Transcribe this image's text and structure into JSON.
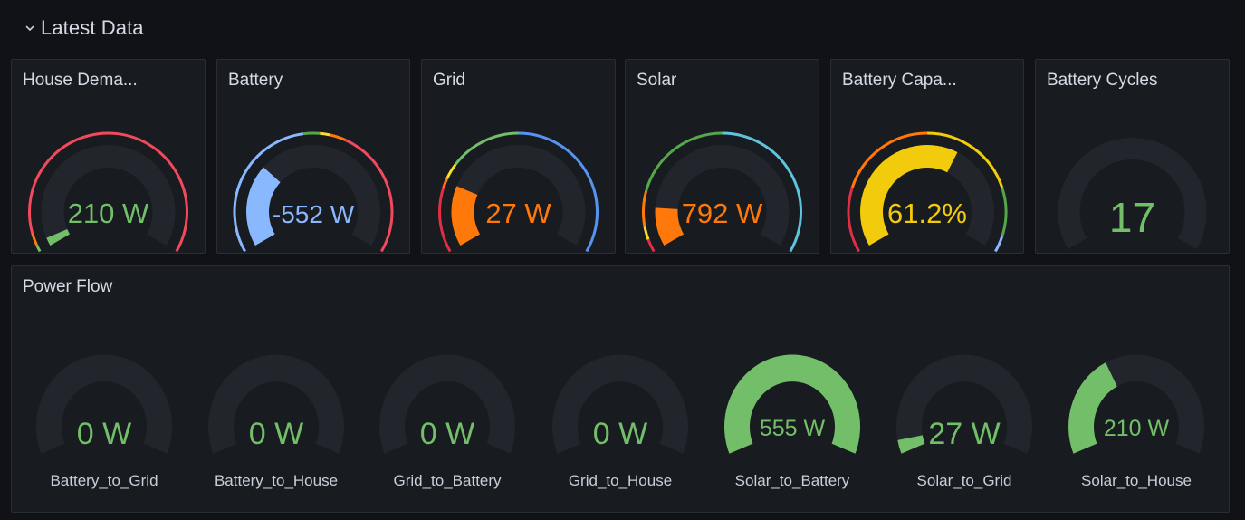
{
  "row": {
    "title": "Latest Data",
    "collapse_icon": "chevron-down-icon"
  },
  "colors": {
    "green": "#73bf69",
    "dark_green": "#56a64b",
    "red": "#f2495c",
    "dark_red": "#e02f44",
    "orange": "#ff780a",
    "yellow": "#f2cc0c",
    "light_yellow": "#fade2a",
    "blue": "#8ab8ff",
    "mid_blue": "#5794f2",
    "cyan": "#5ec4dc",
    "track": "#22252b",
    "panel_bg": "#181b1f",
    "page_bg": "#111217"
  },
  "stat_panels": [
    {
      "id": "house-demand",
      "title": "House Dema...",
      "value_text": "210 W",
      "value_color": "#73bf69",
      "fill_fraction": 0.03,
      "fill_color": "#73bf69",
      "thresholds": [
        {
          "to": 0.02,
          "color": "#73bf69"
        },
        {
          "to": 0.06,
          "color": "#ff780a"
        },
        {
          "to": 1.0,
          "color": "#f2495c"
        }
      ]
    },
    {
      "id": "battery",
      "title": "Battery",
      "value_text": "-552 W",
      "value_color": "#8ab8ff",
      "fill_fraction": 0.3,
      "fill_color": "#8ab8ff",
      "thresholds": [
        {
          "to": 0.47,
          "color": "#8ab8ff"
        },
        {
          "to": 0.52,
          "color": "#56a64b"
        },
        {
          "to": 0.55,
          "color": "#fade2a"
        },
        {
          "to": 0.6,
          "color": "#ff780a"
        },
        {
          "to": 1.0,
          "color": "#f2495c"
        }
      ]
    },
    {
      "id": "grid",
      "title": "Grid",
      "value_text": "27 W",
      "value_color": "#ff780a",
      "fill_fraction": 0.22,
      "fill_color": "#ff780a",
      "thresholds": [
        {
          "to": 0.2,
          "color": "#e02f44"
        },
        {
          "to": 0.23,
          "color": "#ff780a"
        },
        {
          "to": 0.28,
          "color": "#fade2a"
        },
        {
          "to": 0.5,
          "color": "#73bf69"
        },
        {
          "to": 1.0,
          "color": "#5794f2"
        }
      ]
    },
    {
      "id": "solar",
      "title": "Solar",
      "value_text": "792 W",
      "value_color": "#ff780a",
      "fill_fraction": 0.14,
      "fill_color": "#ff780a",
      "thresholds": [
        {
          "to": 0.04,
          "color": "#e02f44"
        },
        {
          "to": 0.08,
          "color": "#fade2a"
        },
        {
          "to": 0.19,
          "color": "#ff780a"
        },
        {
          "to": 0.5,
          "color": "#56a64b"
        },
        {
          "to": 1.0,
          "color": "#5ec4dc"
        }
      ]
    },
    {
      "id": "battery-capacity",
      "title": "Battery Capa...",
      "value_text": "61.2%",
      "value_color": "#f2cc0c",
      "fill_fraction": 0.612,
      "fill_color": "#f2cc0c",
      "thresholds": [
        {
          "to": 0.2,
          "color": "#e02f44"
        },
        {
          "to": 0.5,
          "color": "#ff780a"
        },
        {
          "to": 0.8,
          "color": "#f2cc0c"
        },
        {
          "to": 0.95,
          "color": "#56a64b"
        },
        {
          "to": 1.0,
          "color": "#8ab8ff"
        }
      ]
    },
    {
      "id": "battery-cycles",
      "title": "Battery Cycles",
      "value_text": "17",
      "value_color": "#73bf69",
      "fill_fraction": 0,
      "fill_color": "#73bf69",
      "thresholds": []
    }
  ],
  "power_flow": {
    "title": "Power Flow",
    "gauges": [
      {
        "label": "Battery_to_Grid",
        "value_text": "0 W",
        "fill_fraction": 0
      },
      {
        "label": "Battery_to_House",
        "value_text": "0 W",
        "fill_fraction": 0
      },
      {
        "label": "Grid_to_Battery",
        "value_text": "0 W",
        "fill_fraction": 0
      },
      {
        "label": "Grid_to_House",
        "value_text": "0 W",
        "fill_fraction": 0
      },
      {
        "label": "Solar_to_Battery",
        "value_text": "555 W",
        "fill_fraction": 1.0
      },
      {
        "label": "Solar_to_Grid",
        "value_text": "27 W",
        "fill_fraction": 0.05
      },
      {
        "label": "Solar_to_House",
        "value_text": "210 W",
        "fill_fraction": 0.38
      }
    ],
    "value_color": "#73bf69",
    "fill_color": "#73bf69"
  }
}
